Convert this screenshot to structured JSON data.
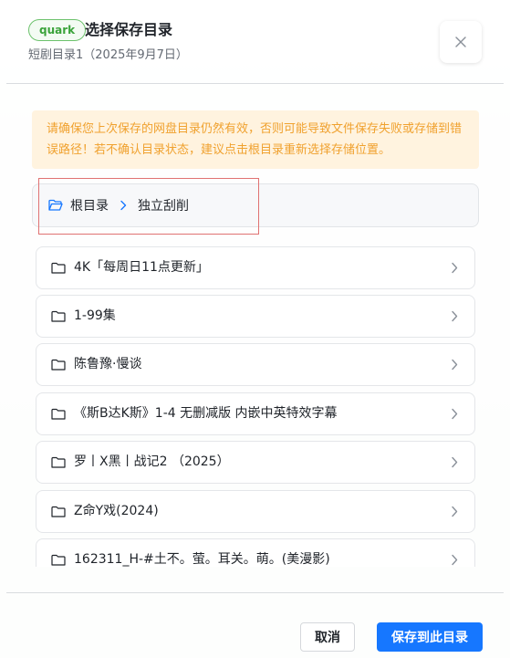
{
  "dialog": {
    "badge": "quark",
    "title": "选择保存目录",
    "subtitle": "短剧目录1（2025年9月7日）"
  },
  "notice": {
    "text": "请确保您上次保存的网盘目录仍然有效，否则可能导致文件保存失败或存储到错误路径！若不确认目录状态，建议点击根目录重新选择存储位置。"
  },
  "breadcrumb": {
    "root": "根目录",
    "current": "独立刮削"
  },
  "folders": [
    "4K「每周日11点更新」",
    "1-99集",
    "陈鲁豫·慢谈",
    "《斯B达K斯》1-4 无删减版 内嵌中英特效字幕",
    "罗丨X黑丨战记2 （2025）",
    "Z命Y戏(2024)",
    "162311_H-#土不。萤。耳关。萌。(美漫影)"
  ],
  "footer": {
    "cancel_label": "取消",
    "save_label": "保存到此目录"
  },
  "colors": {
    "primary": "#1677ff",
    "badge_green": "#3aa33a",
    "notice_text": "#f0a12e",
    "notice_bg": "#fff3df"
  },
  "icons": {
    "close": "close-icon",
    "folder": "folder-icon",
    "folder_open": "folder-open-icon",
    "chevron": "chevron-right-icon"
  }
}
